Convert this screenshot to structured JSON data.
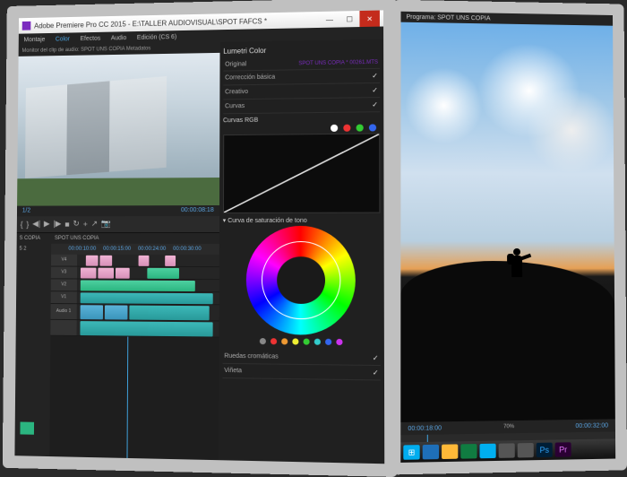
{
  "app": {
    "title": "Adobe Premiere Pro CC 2015 - E:\\TALLER AUDIOVISUAL\\SPOT FAFCS *",
    "menus": [
      "Montaje",
      "Color",
      "Efectos",
      "Audio",
      "Edición (CS 6)"
    ],
    "active_workspace": "Color"
  },
  "source": {
    "tab": "Monitor del clip de audio: SPOT UNS COPIA  Metadatos",
    "left_tc": "1/2",
    "right_tc": "00:00:08:18"
  },
  "project": {
    "title": "S COPIA",
    "row": "5 2"
  },
  "timeline": {
    "seq_name": "SPOT UNS COPIA",
    "ticks": [
      "00:00:10:00",
      "00:00:15:00",
      "00:00:24:00",
      "00:00:30:00"
    ],
    "tracks": {
      "v4": "V4",
      "v3": "V3",
      "v2": "V2",
      "v1": "V1",
      "a1": "Audio 1"
    }
  },
  "lumetri": {
    "title": "Lumetri Color",
    "master_label": "Original",
    "clip_label": "SPOT UNS COPIA * 00261.MTS",
    "sections": {
      "basic": "Corrección básica",
      "creative": "Creativo",
      "curves": "Curvas",
      "rgb_curves": "Curvas RGB",
      "hue_sat": "Curva de saturación de tono",
      "wheels": "Ruedas cromáticas",
      "vignette": "Viñeta"
    }
  },
  "program": {
    "tab": "Programa: SPOT UNS COPIA",
    "left_tc": "00:00:18:00",
    "fit": "70%",
    "right_tc": "00:00:32:00"
  },
  "icons": {
    "play": "▶",
    "step_back": "◀|",
    "step_fwd": "|▶",
    "stop": "■",
    "loop": "↻",
    "mark_in": "{",
    "mark_out": "}",
    "add": "+",
    "export": "↗",
    "camera": "📷"
  }
}
